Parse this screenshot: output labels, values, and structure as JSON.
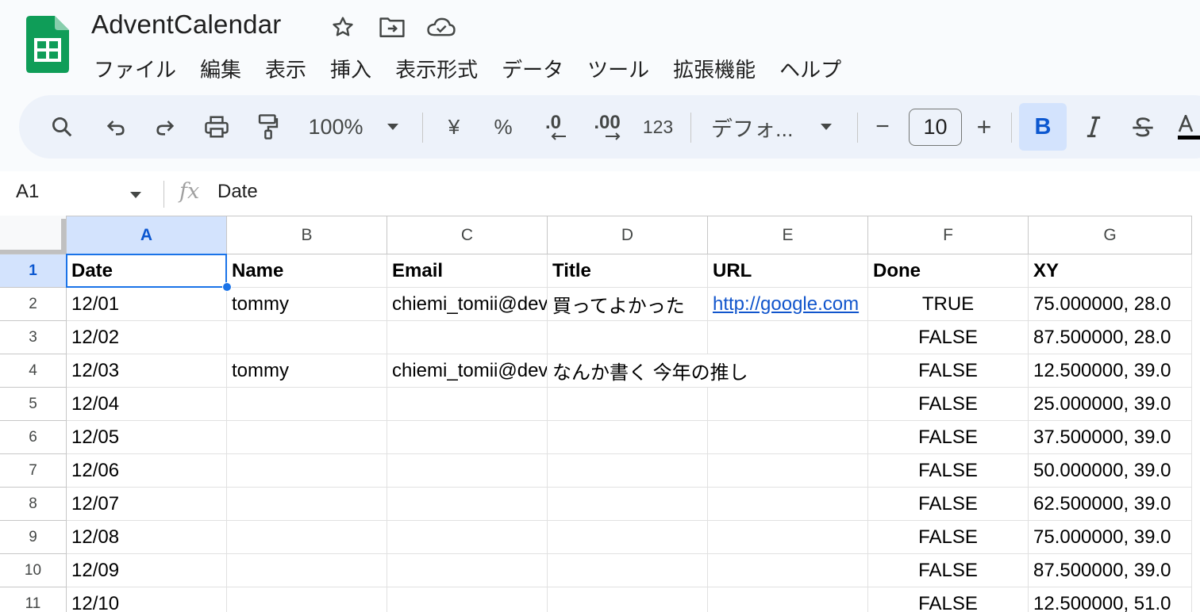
{
  "doc": {
    "title": "AdventCalendar"
  },
  "menu": [
    "ファイル",
    "編集",
    "表示",
    "挿入",
    "表示形式",
    "データ",
    "ツール",
    "拡張機能",
    "ヘルプ"
  ],
  "toolbar": {
    "zoom": "100%",
    "currency": "¥",
    "percent": "%",
    "dec_decrease": ".0",
    "dec_increase": ".00",
    "number_format": "123",
    "font": "デフォ...",
    "font_size": "10",
    "minus": "−",
    "plus": "+",
    "bold": "B"
  },
  "formula_bar": {
    "cell_ref": "A1",
    "content": "Date"
  },
  "grid": {
    "columns": [
      "A",
      "B",
      "C",
      "D",
      "E",
      "F",
      "G"
    ],
    "selected_column": "A",
    "selected_row": 1,
    "rows": [
      {
        "n": "1",
        "cells": [
          "Date",
          "Name",
          "Email",
          "Title",
          "URL",
          "Done",
          "XY"
        ]
      },
      {
        "n": "2",
        "cells": [
          "12/01",
          "tommy",
          "chiemi_tomii@dev",
          "買ってよかった",
          "http://google.com",
          "TRUE",
          "75.000000, 28.0"
        ]
      },
      {
        "n": "3",
        "cells": [
          "12/02",
          "",
          "",
          "",
          "",
          "FALSE",
          "87.500000, 28.0"
        ]
      },
      {
        "n": "4",
        "cells": [
          "12/03",
          "tommy",
          "chiemi_tomii@dev",
          "なんか書く 今年の推し",
          "",
          "FALSE",
          "12.500000, 39.0"
        ]
      },
      {
        "n": "5",
        "cells": [
          "12/04",
          "",
          "",
          "",
          "",
          "FALSE",
          "25.000000, 39.0"
        ]
      },
      {
        "n": "6",
        "cells": [
          "12/05",
          "",
          "",
          "",
          "",
          "FALSE",
          "37.500000, 39.0"
        ]
      },
      {
        "n": "7",
        "cells": [
          "12/06",
          "",
          "",
          "",
          "",
          "FALSE",
          "50.000000, 39.0"
        ]
      },
      {
        "n": "8",
        "cells": [
          "12/07",
          "",
          "",
          "",
          "",
          "FALSE",
          "62.500000, 39.0"
        ]
      },
      {
        "n": "9",
        "cells": [
          "12/08",
          "",
          "",
          "",
          "",
          "FALSE",
          "75.000000, 39.0"
        ]
      },
      {
        "n": "10",
        "cells": [
          "12/09",
          "",
          "",
          "",
          "",
          "FALSE",
          "87.500000, 39.0"
        ]
      },
      {
        "n": "11",
        "cells": [
          "12/10",
          "",
          "",
          "",
          "",
          "FALSE",
          "12.500000, 51.0"
        ]
      }
    ]
  },
  "colors": {
    "accent": "#1a73e8",
    "selected_header": "#d3e3fd",
    "sheets_green": "#0f9d58",
    "link": "#1155cc"
  }
}
